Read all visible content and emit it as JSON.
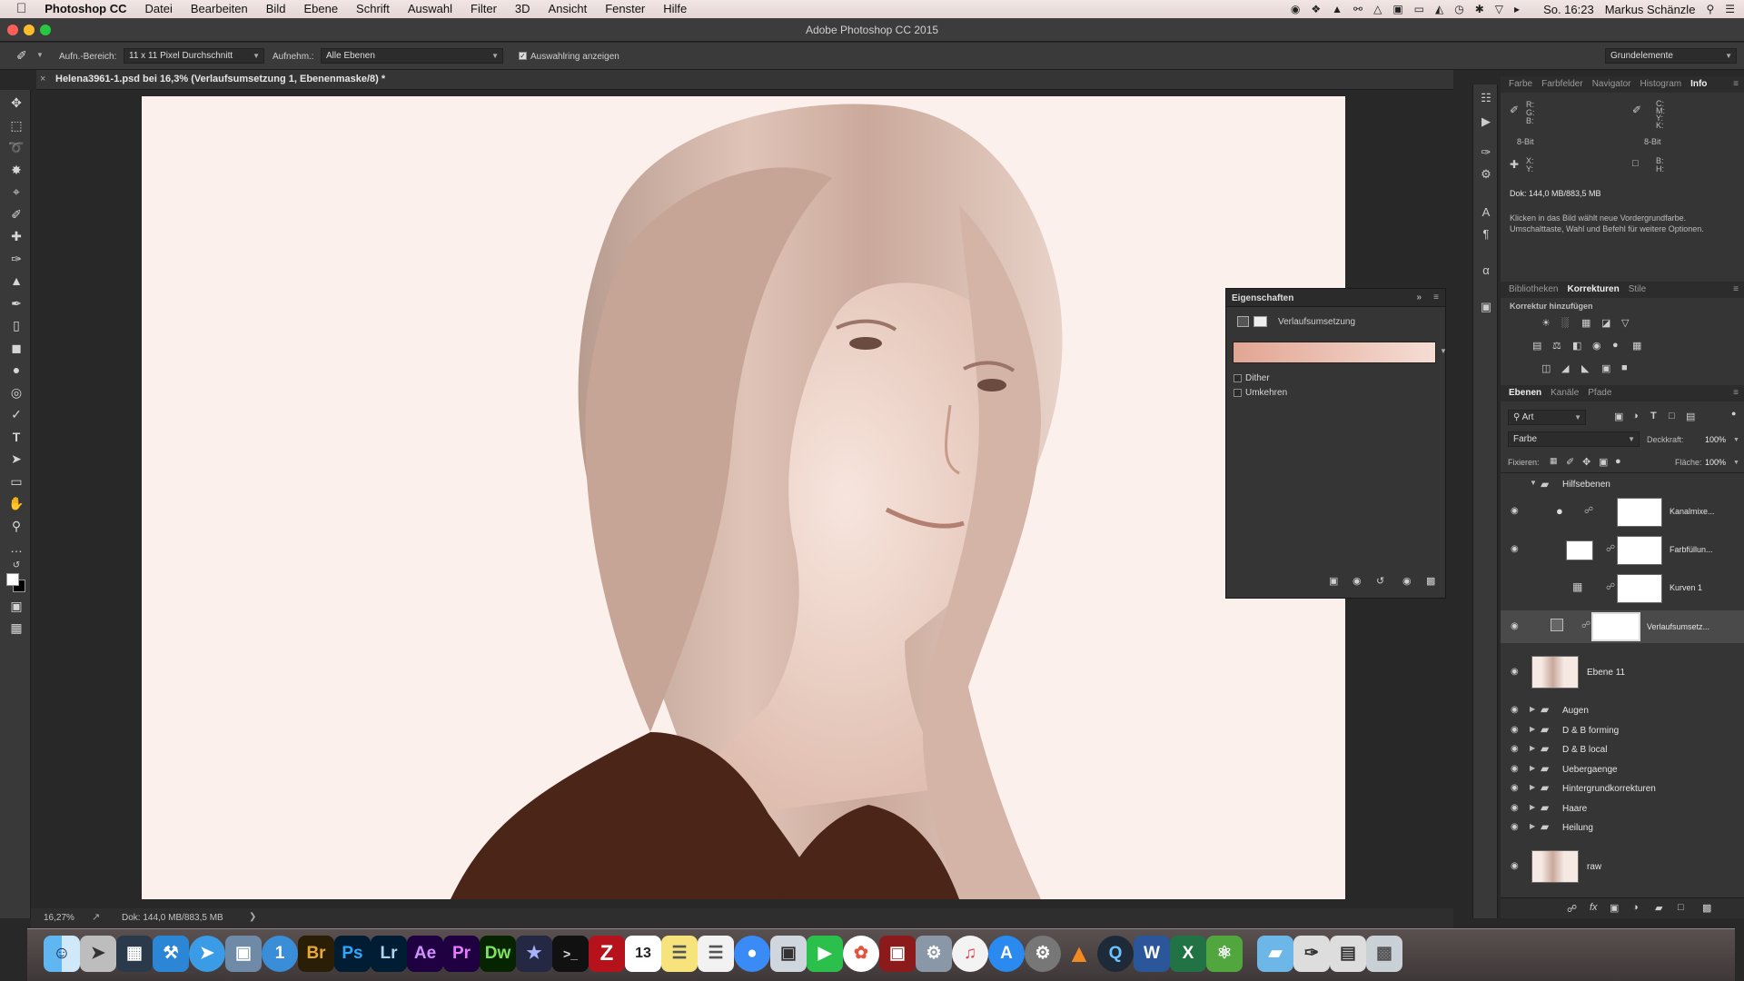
{
  "menubar": {
    "apple": "",
    "app": "Photoshop CC",
    "items": [
      "Datei",
      "Bearbeiten",
      "Bild",
      "Ebene",
      "Schrift",
      "Auswahl",
      "Filter",
      "3D",
      "Ansicht",
      "Fenster",
      "Hilfe"
    ],
    "clock": "So. 16:23",
    "user": "Markus Schänzle"
  },
  "window": {
    "title": "Adobe Photoshop CC 2015"
  },
  "options": {
    "sample_label": "Aufn.-Bereich:",
    "sample_value": "11 x 11 Pixel Durchschnitt",
    "sample_from_label": "Aufnehm.:",
    "sample_from_value": "Alle Ebenen",
    "show_ring_label": "Auswahlring anzeigen",
    "workspace": "Grundelemente"
  },
  "document": {
    "tab_title": "Helena3961-1.psd bei 16,3% (Verlaufsumsetzung 1, Ebenenmaske/8) *",
    "close": "×"
  },
  "status": {
    "zoom": "16,27%",
    "doc_size": "Dok: 144,0 MB/883,5 MB"
  },
  "properties": {
    "title": "Eigenschaften",
    "adjustment": "Verlaufsumsetzung",
    "gradient": {
      "from": "#e2a593",
      "to": "#f5ddd4"
    },
    "dither": "Dither",
    "reverse": "Umkehren"
  },
  "info": {
    "tabs": [
      "Farbe",
      "Farbfelder",
      "Navigator",
      "Histogram",
      "Info"
    ],
    "active": "Info",
    "rgb": [
      "R:",
      "G:",
      "B:"
    ],
    "cmyk": [
      "C:",
      "M:",
      "Y:",
      "K:"
    ],
    "bit_left": "8-Bit",
    "bit_right": "8-Bit",
    "xy": [
      "X:",
      "Y:"
    ],
    "bh": [
      "B:",
      "H:"
    ],
    "doc": "Dok: 144,0 MB/883,5 MB",
    "hint": "Klicken in das Bild wählt neue Vordergrundfarbe. Umschalttaste, Wahl und Befehl für weitere Optionen."
  },
  "adjustments": {
    "tabs": [
      "Bibliotheken",
      "Korrekturen",
      "Stile"
    ],
    "active": "Korrekturen",
    "heading": "Korrektur hinzufügen"
  },
  "layers": {
    "tabs": [
      "Ebenen",
      "Kanäle",
      "Pfade"
    ],
    "active": "Ebenen",
    "filter": "Art",
    "blend": "Farbe",
    "opacity_label": "Deckkraft:",
    "opacity": "100%",
    "lock_label": "Fixieren:",
    "fill_label": "Fläche:",
    "fill": "100%",
    "group": "Hilfsebenen",
    "items": [
      {
        "name": "Kanalmixe..."
      },
      {
        "name": "Farbfüllun..."
      },
      {
        "name": "Kurven 1"
      },
      {
        "name": "Verlaufsumsetz..."
      },
      {
        "name": "Ebene 11"
      }
    ],
    "groups": [
      "Augen",
      "D & B forming",
      "D & B local",
      "Uebergaenge",
      "Hintergrundkorrekturen",
      "Haare",
      "Heilung"
    ],
    "bottom": "raw"
  },
  "dock": {
    "apps": [
      "Finder",
      "Launchpad",
      "Mission",
      "Xcode",
      "Safari",
      "Vorschau",
      "1Password",
      "Br",
      "Ps",
      "Lr",
      "Ae",
      "Pr",
      "Dw",
      "iMovie",
      "Terminal",
      "FileZilla",
      "13",
      "Notizen",
      "Erinnerungen",
      "Messages",
      "Fotos",
      "FaceTime",
      "Photos",
      "Photo Booth",
      "Automator",
      "iTunes",
      "App Store",
      "Systemeinstellungen",
      "VLC",
      "Quicktime",
      "W",
      "X",
      "Evernote",
      "Ordner",
      "Brushes",
      "Screenshots",
      "Papierkorb"
    ]
  }
}
